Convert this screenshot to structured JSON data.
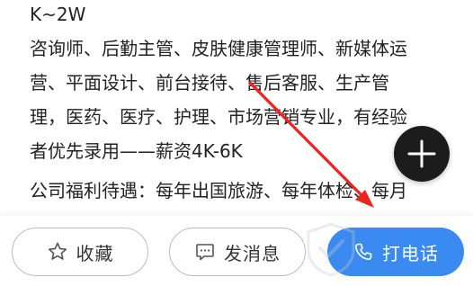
{
  "job_description": {
    "lines": [
      "K~2W",
      "咨询师、后勤主管、皮肤健康管理师、新媒体运",
      "营、平面设计、前台接待、售后客服、生产管",
      "理，医药、医疗、护理、市场营销专业，有经验",
      "者优先录用——薪资4K-6K",
      "公司福利待遇：每年出国旅游、每年体检、每月"
    ]
  },
  "fab": {
    "icon": "plus-icon"
  },
  "bottom_bar": {
    "favorite": {
      "label": "收藏",
      "icon": "star-outline-icon"
    },
    "message": {
      "label": "发消息",
      "icon": "chat-bubble-icon"
    },
    "call": {
      "label": "打电话",
      "icon": "phone-icon"
    }
  },
  "colors": {
    "call_button": "#3a8af2",
    "fab": "#1c1c1c",
    "annotation_arrow": "#e8261f",
    "text": "#222222"
  }
}
